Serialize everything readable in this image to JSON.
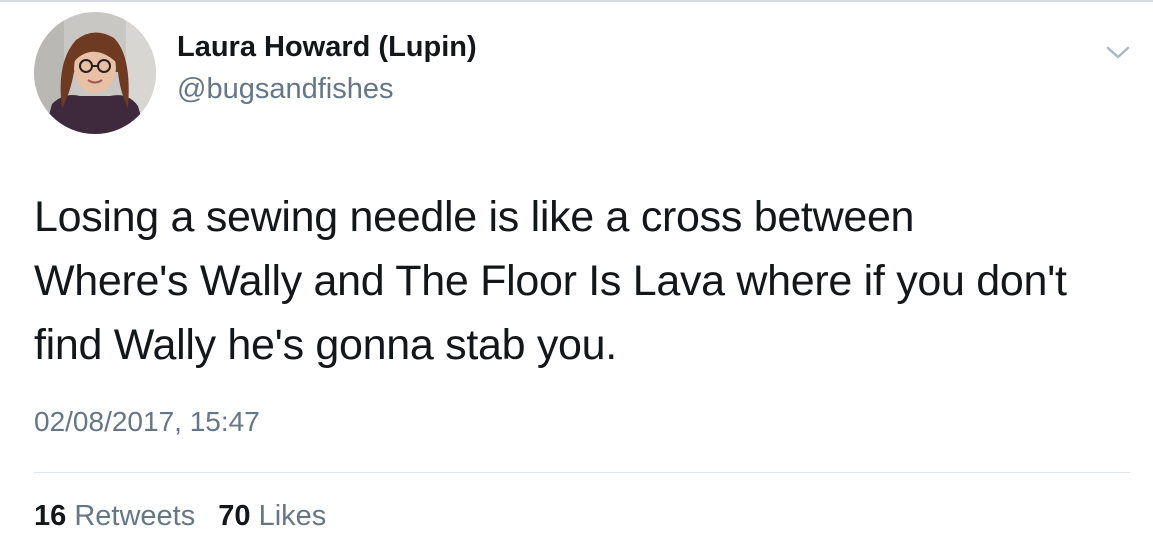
{
  "author": {
    "display_name": "Laura Howard (Lupin)",
    "handle": "@bugsandfishes"
  },
  "tweet": {
    "text_lines": [
      "Losing a sewing needle is like a cross between",
      "Where's Wally and The Floor Is Lava where if you don't",
      "find Wally he's gonna stab you."
    ],
    "timestamp": "02/08/2017, 15:47"
  },
  "stats": {
    "retweets_count": "16",
    "retweets_label": "Retweets",
    "likes_count": "70",
    "likes_label": "Likes"
  },
  "icons": {
    "menu": "chevron-down-icon",
    "avatar": "profile-photo"
  },
  "colors": {
    "text_primary": "#14171a",
    "text_secondary": "#657786",
    "divider": "#e1e8ed"
  }
}
